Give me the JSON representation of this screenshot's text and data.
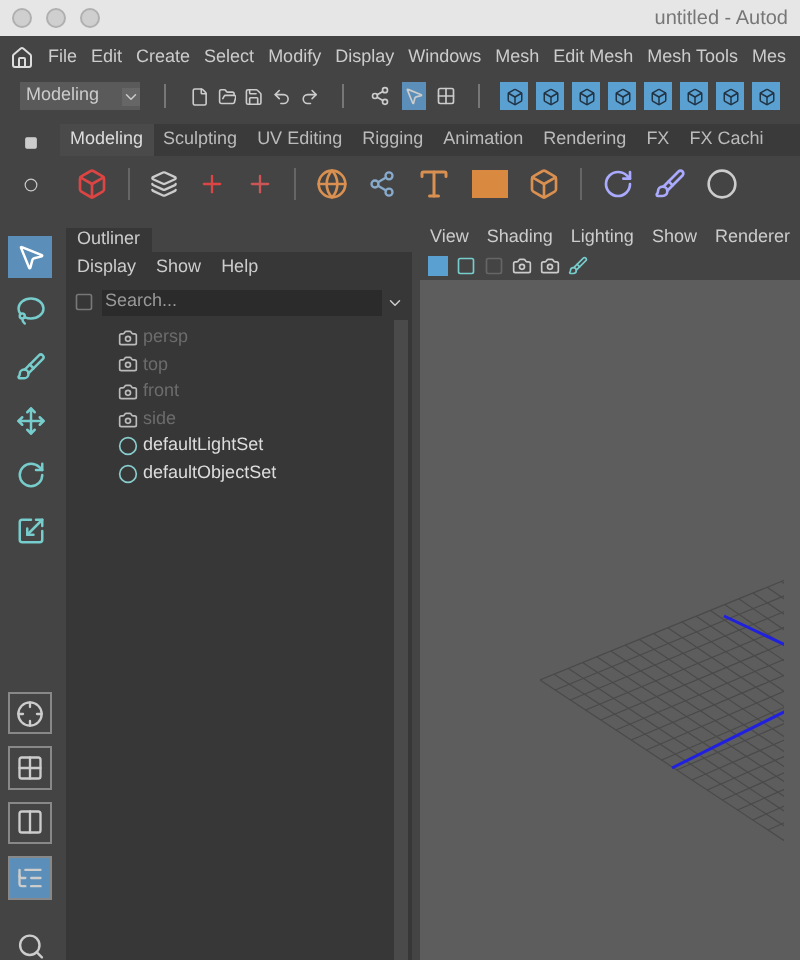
{
  "window": {
    "title": "untitled - Autod"
  },
  "menu": [
    "File",
    "Edit",
    "Create",
    "Select",
    "Modify",
    "Display",
    "Windows",
    "Mesh",
    "Edit Mesh",
    "Mesh Tools",
    "Mes"
  ],
  "mode_dropdown": {
    "value": "Modeling"
  },
  "selection_masks": [
    {
      "kind": "hierarchy",
      "selected": false
    },
    {
      "kind": "object",
      "selected": true
    },
    {
      "kind": "component",
      "selected": false
    }
  ],
  "shelf_tabs": [
    {
      "label": "Modeling",
      "selected": true
    },
    {
      "label": "Sculpting",
      "selected": false
    },
    {
      "label": "UV Editing",
      "selected": false
    },
    {
      "label": "Rigging",
      "selected": false
    },
    {
      "label": "Animation",
      "selected": false
    },
    {
      "label": "Rendering",
      "selected": false
    },
    {
      "label": "FX",
      "selected": false
    },
    {
      "label": "FX Cachi",
      "selected": false
    }
  ],
  "toolbox": [
    {
      "kind": "select",
      "selected": true
    },
    {
      "kind": "lasso",
      "selected": false
    },
    {
      "kind": "paint",
      "selected": false
    },
    {
      "kind": "move",
      "selected": false
    },
    {
      "kind": "rotate",
      "selected": false
    },
    {
      "kind": "scale",
      "selected": false
    }
  ],
  "layouts": [
    {
      "kind": "single",
      "selected": false
    },
    {
      "kind": "four",
      "selected": false
    },
    {
      "kind": "two",
      "selected": false
    },
    {
      "kind": "outliner",
      "selected": true
    }
  ],
  "outliner": {
    "tab": "Outliner",
    "menu": [
      "Display",
      "Show",
      "Help"
    ],
    "search": {
      "placeholder": "Search..."
    },
    "items": [
      {
        "kind": "camera",
        "label": "persp",
        "dimmed": true
      },
      {
        "kind": "camera",
        "label": "top",
        "dimmed": true
      },
      {
        "kind": "camera",
        "label": "front",
        "dimmed": true
      },
      {
        "kind": "camera",
        "label": "side",
        "dimmed": true
      },
      {
        "kind": "set",
        "label": "defaultLightSet",
        "dimmed": false
      },
      {
        "kind": "set",
        "label": "defaultObjectSet",
        "dimmed": false
      }
    ]
  },
  "viewport": {
    "menu": [
      "View",
      "Shading",
      "Lighting",
      "Show",
      "Renderer"
    ]
  }
}
